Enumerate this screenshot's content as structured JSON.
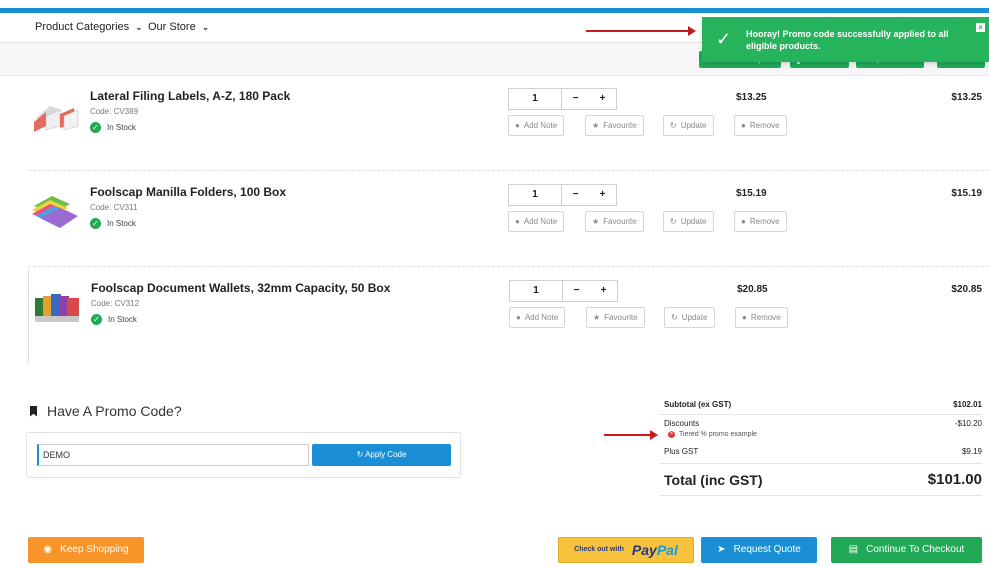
{
  "nav": {
    "items": [
      {
        "label": "Product Categories"
      },
      {
        "label": "Our Store"
      }
    ]
  },
  "toolbar": {
    "save_template": "Save As Template",
    "hold_order": "Hold Order",
    "update_order": "Update Order",
    "remove": "Remove"
  },
  "toast": {
    "message": "Hooray! Promo code successfully applied to all eligible products."
  },
  "items": [
    {
      "name": "Lateral Filing Labels, A-Z, 180 Pack",
      "code": "Code: CV389",
      "stock": "In Stock",
      "qty": "1",
      "unit_price": "$13.25",
      "line_total": "$13.25"
    },
    {
      "name": "Foolscap Manilla Folders, 100 Box",
      "code": "Code: CV311",
      "stock": "In Stock",
      "qty": "1",
      "unit_price": "$15.19",
      "line_total": "$15.19"
    },
    {
      "name": "Foolscap Document Wallets, 32mm Capacity, 50 Box",
      "code": "Code: CV312",
      "stock": "In Stock",
      "qty": "1",
      "unit_price": "$20.85",
      "line_total": "$20.85"
    }
  ],
  "row_actions": {
    "add_note": "Add Note",
    "favourite": "Favourite",
    "update": "Update",
    "remove": "Remove",
    "minus": "−",
    "plus": "+"
  },
  "promo": {
    "title": "Have A Promo Code?",
    "value": "DEMO",
    "apply_label": "Apply Code"
  },
  "summary": {
    "subtotal_label": "Subtotal (ex GST)",
    "subtotal_value": "$102.01",
    "discounts_label": "Discounts",
    "discounts_value": "-$10.20",
    "discount_detail": "Tiered % promo example",
    "gst_label": "Plus GST",
    "gst_value": "$9.19",
    "total_label": "Total (inc GST)",
    "total_value": "$101.00"
  },
  "actions": {
    "keep_shopping": "Keep Shopping",
    "paypal_prefix": "Check out with",
    "paypal_brand_1": "Pay",
    "paypal_brand_2": "Pal",
    "request_quote": "Request Quote",
    "checkout": "Continue To Checkout"
  },
  "colors": {
    "accent": "#1a8fd6",
    "success": "#21a957",
    "orange": "#f7942a",
    "paypal": "#f9c23c"
  }
}
